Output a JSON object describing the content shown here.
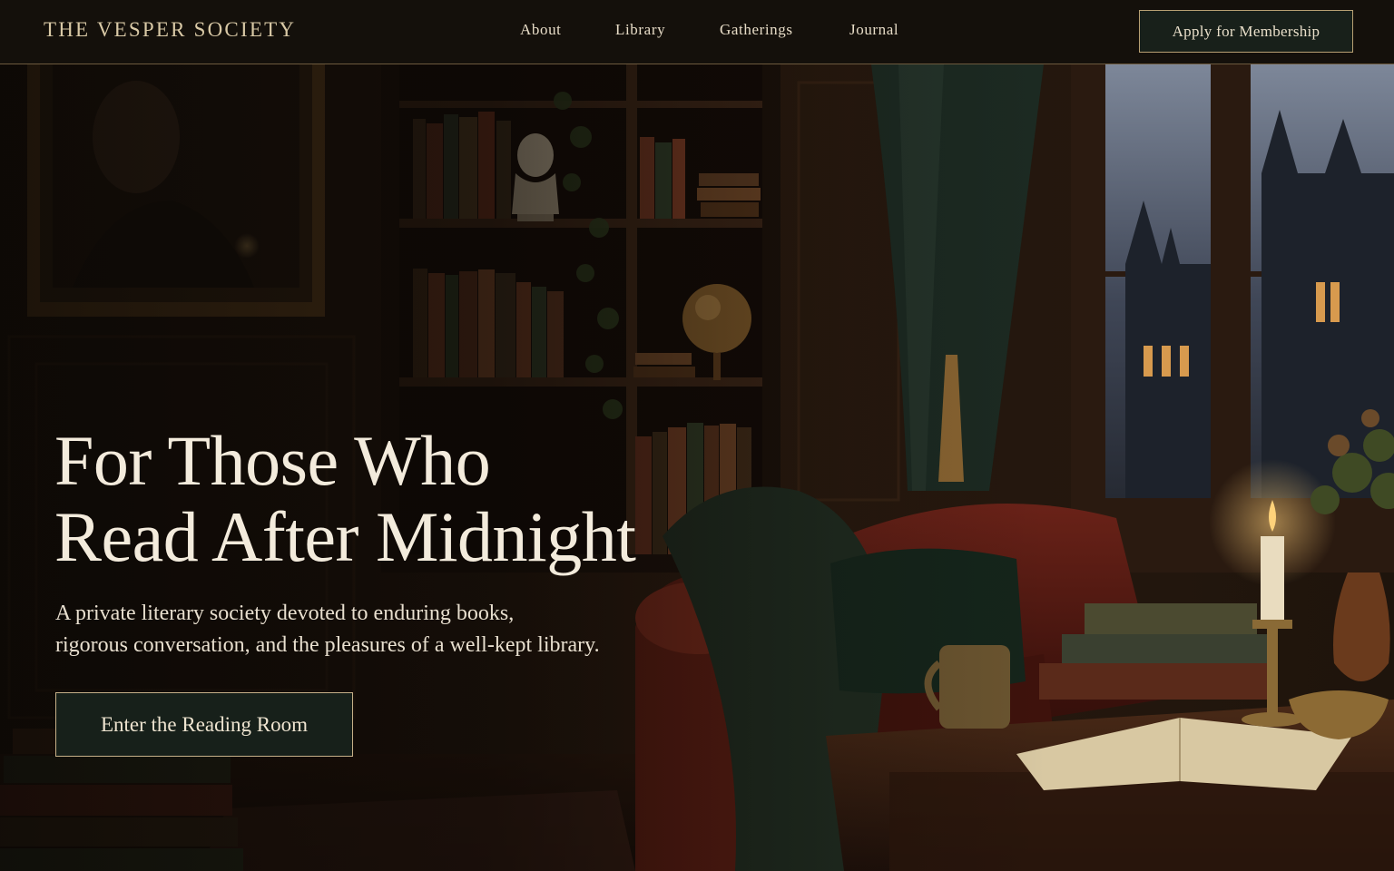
{
  "brand": {
    "name": "The Vesper Society"
  },
  "nav": {
    "links": [
      {
        "label": "About"
      },
      {
        "label": "Library"
      },
      {
        "label": "Gatherings"
      },
      {
        "label": "Journal"
      }
    ],
    "cta_label": "Apply for Membership"
  },
  "hero": {
    "title_line_1": "For Those Who",
    "title_line_2": "Read After Midnight",
    "subtitle_line_1": "A private literary society devoted to enduring books,",
    "subtitle_line_2": "rigorous conversation, and the pleasures of a well-kept library.",
    "cta_label": "Enter the Reading Room"
  },
  "colors": {
    "nav_background": "#14100b",
    "accent_gold": "#b8a073",
    "button_green": "#18201a",
    "text_cream": "#f3ebdc"
  }
}
